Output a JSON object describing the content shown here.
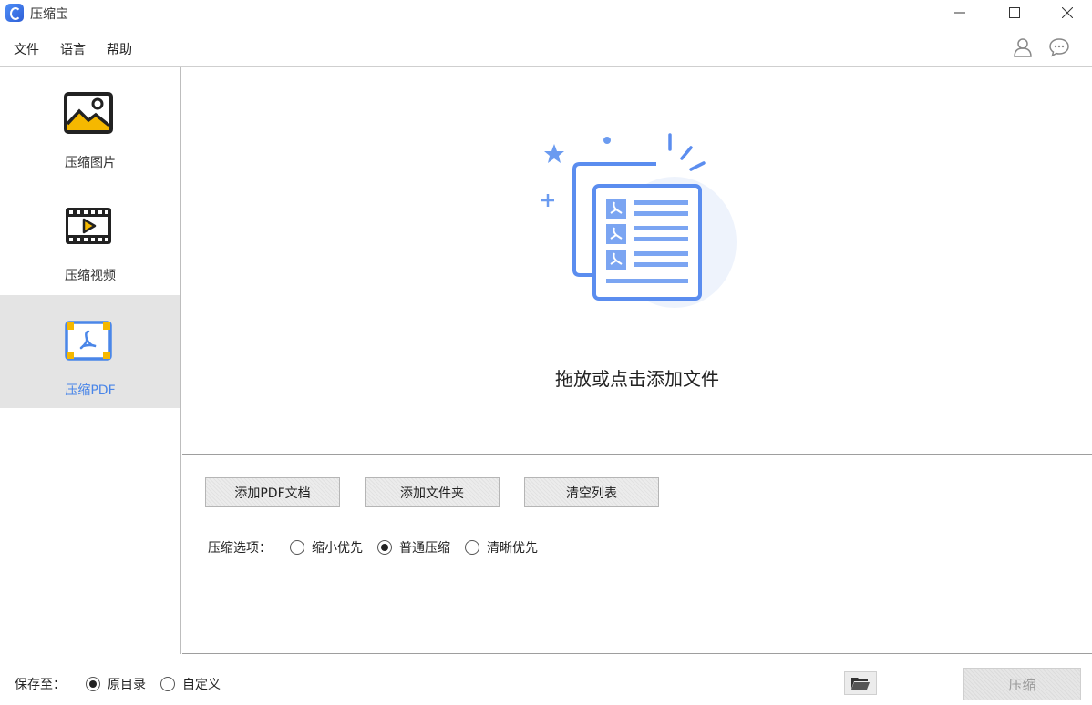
{
  "window": {
    "title": "压缩宝"
  },
  "menu": {
    "items": [
      "文件",
      "语言",
      "帮助"
    ]
  },
  "sidebar": {
    "items": [
      {
        "label": "压缩图片",
        "icon": "image-icon",
        "active": false
      },
      {
        "label": "压缩视频",
        "icon": "video-icon",
        "active": false
      },
      {
        "label": "压缩PDF",
        "icon": "pdf-icon",
        "active": true
      }
    ],
    "active_color": "#4a86e8"
  },
  "dropzone": {
    "text": "拖放或点击添加文件"
  },
  "controls": {
    "add_pdf_label": "添加PDF文档",
    "add_folder_label": "添加文件夹",
    "clear_label": "清空列表",
    "options_label": "压缩选项：",
    "options": [
      {
        "label": "缩小优先",
        "checked": false
      },
      {
        "label": "普通压缩",
        "checked": true
      },
      {
        "label": "清晰优先",
        "checked": false
      }
    ]
  },
  "footer": {
    "save_label": "保存至：",
    "save_options": [
      {
        "label": "原目录",
        "checked": true
      },
      {
        "label": "自定义",
        "checked": false
      }
    ],
    "compress_label": "压缩"
  },
  "colors": {
    "accent": "#4a86e8",
    "illustration": "#5b8def"
  }
}
